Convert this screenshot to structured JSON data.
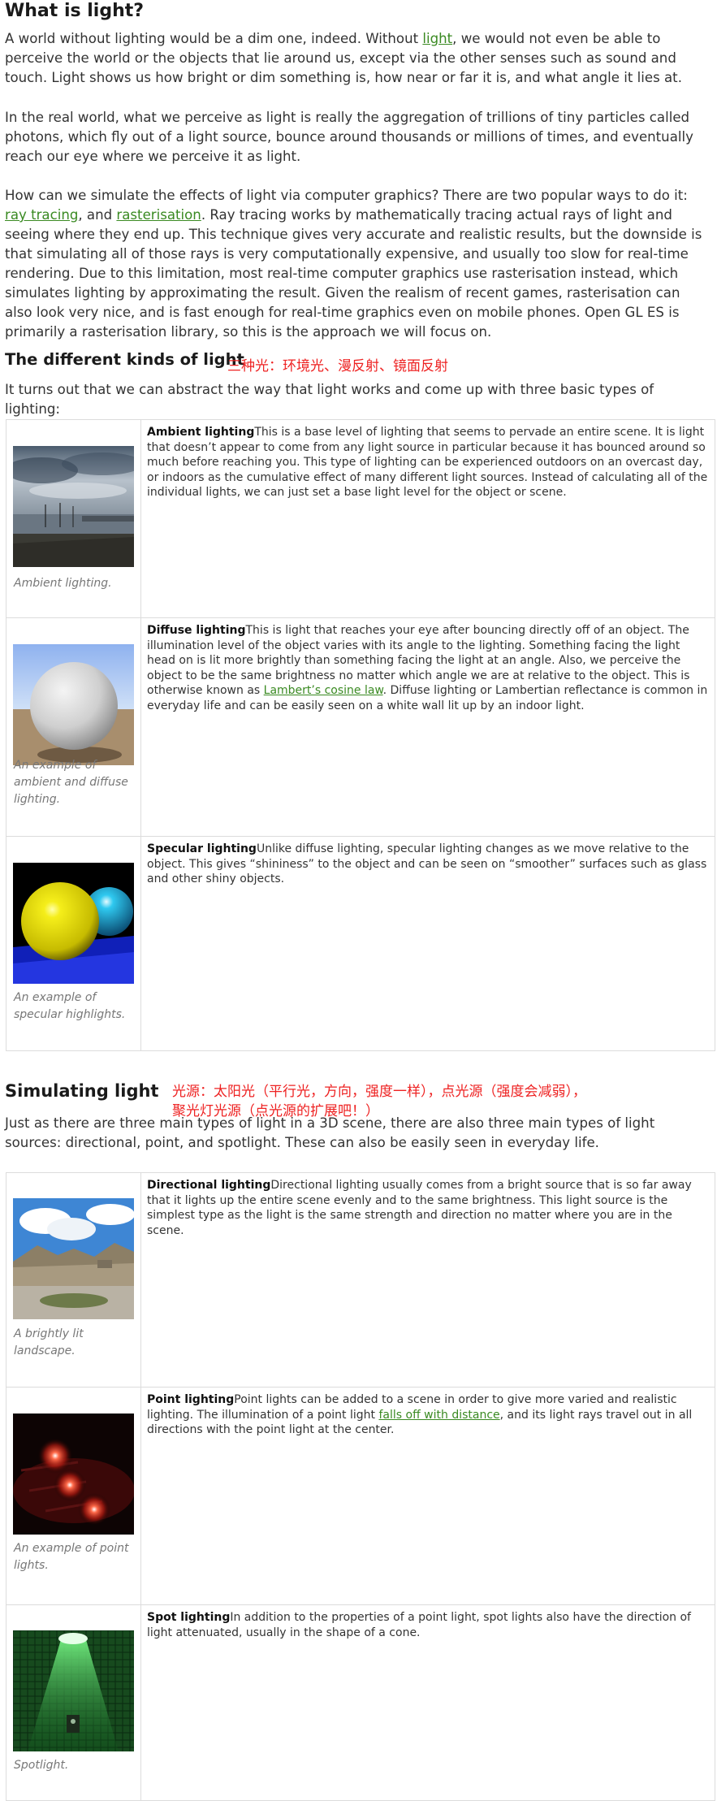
{
  "sections": {
    "what": {
      "heading": "What is light?",
      "p1": {
        "before": "A world without lighting would be a dim one, indeed. Without ",
        "link": "light",
        "after": ", we would not even be able to perceive the world or the objects that lie around us, except via the other senses such as sound and touch. Light shows us how bright or dim something is, how near or far it is, and what angle it lies at."
      },
      "p2": "In the real world, what we perceive as light is really the aggregation of trillions of tiny particles called photons, which fly out of a light source, bounce around thousands or millions of times, and eventually reach our eye where we perceive it as light.",
      "p3": {
        "before": "How can we simulate the effects of light via computer graphics? There are two popular ways to do it: ",
        "link1": "ray tracing",
        "mid": ", and ",
        "link2": "rasterisation",
        "after": ". Ray tracing works by mathematically tracing actual rays of light and seeing where they end up. This technique gives very accurate and realistic results, but the downside is that simulating all of those rays is very computationally expensive, and usually too slow for real-time rendering. Due to this limitation, most real-time computer graphics use rasterisation instead, which simulates lighting by approximating the result. Given the realism of recent games, rasterisation can also look very nice, and is fast enough for real-time graphics even on mobile phones. Open GL ES is primarily a rasterisation library, so this is the approach we will focus on."
      }
    },
    "kinds": {
      "heading": "The different kinds of light",
      "note": "三种光：环境光、漫反射、镜面反射",
      "intro": "It turns out that we can abstract the way that light works and come up with three basic types of lighting:",
      "rows": [
        {
          "title": "Ambient lighting",
          "text": "This is a base level of lighting that seems to pervade an entire scene. It is light that doesn’t appear to come from any light source in particular because it has bounced around so much before reaching you. This type of lighting can be experienced outdoors on an overcast day, or indoors as the cumulative effect of many different light sources. Instead of calculating all of the individual lights, we can just set a base light level for the object or scene.",
          "caption": "Ambient lighting."
        },
        {
          "title": "Diffuse lighting",
          "text_before": "This is light that reaches your eye after bouncing directly off of an object. The illumination level of the object varies with its angle to the lighting. Something facing the light head on is lit more brightly than something facing the light at an angle. Also, we perceive the object to be the same brightness no matter which angle we are at relative to the object. This is otherwise known as ",
          "link": "Lambert’s cosine law",
          "text_after": ". Diffuse lighting or Lambertian reflectance is common in everyday life and can be easily seen on a white wall lit up by an indoor light.",
          "caption": "An example of ambient and diffuse lighting."
        },
        {
          "title": "Specular lighting",
          "text": "Unlike diffuse lighting, specular lighting changes as we move relative to the object. This gives “shininess” to the object and can be seen on “smoother” surfaces such as glass and other shiny objects.",
          "caption": "An example of specular highlights."
        }
      ]
    },
    "simulating": {
      "heading": "Simulating light",
      "note": "光源：太阳光（平行光，方向，强度一样），点光源（强度会减弱），\n聚光灯光源（点光源的扩展吧！）",
      "intro": "Just as there are three main types of light in a 3D scene, there are also three main types of light sources: directional, point, and spotlight. These can also be easily seen in everyday life.",
      "rows": [
        {
          "title": "Directional lighting",
          "text": "Directional lighting usually comes from a bright source that is so far away that it lights up the entire scene evenly and to the same brightness. This light source is the simplest type as the light is the same strength and direction no matter where you are in the scene.",
          "caption": "A brightly lit landscape."
        },
        {
          "title": "Point lighting",
          "text_before": "Point lights can be added to a scene in order to give more varied and realistic lighting. The illumination of a point light ",
          "link": "falls off with distance",
          "text_after": ", and its light rays travel out in all directions with the point light at the center.",
          "caption": "An example of point lights."
        },
        {
          "title": "Spot lighting",
          "text": "In addition to the properties of a point light, spot lights also have the direction of light attenuated, usually in the shape of a cone.",
          "caption": "Spotlight."
        }
      ]
    }
  }
}
